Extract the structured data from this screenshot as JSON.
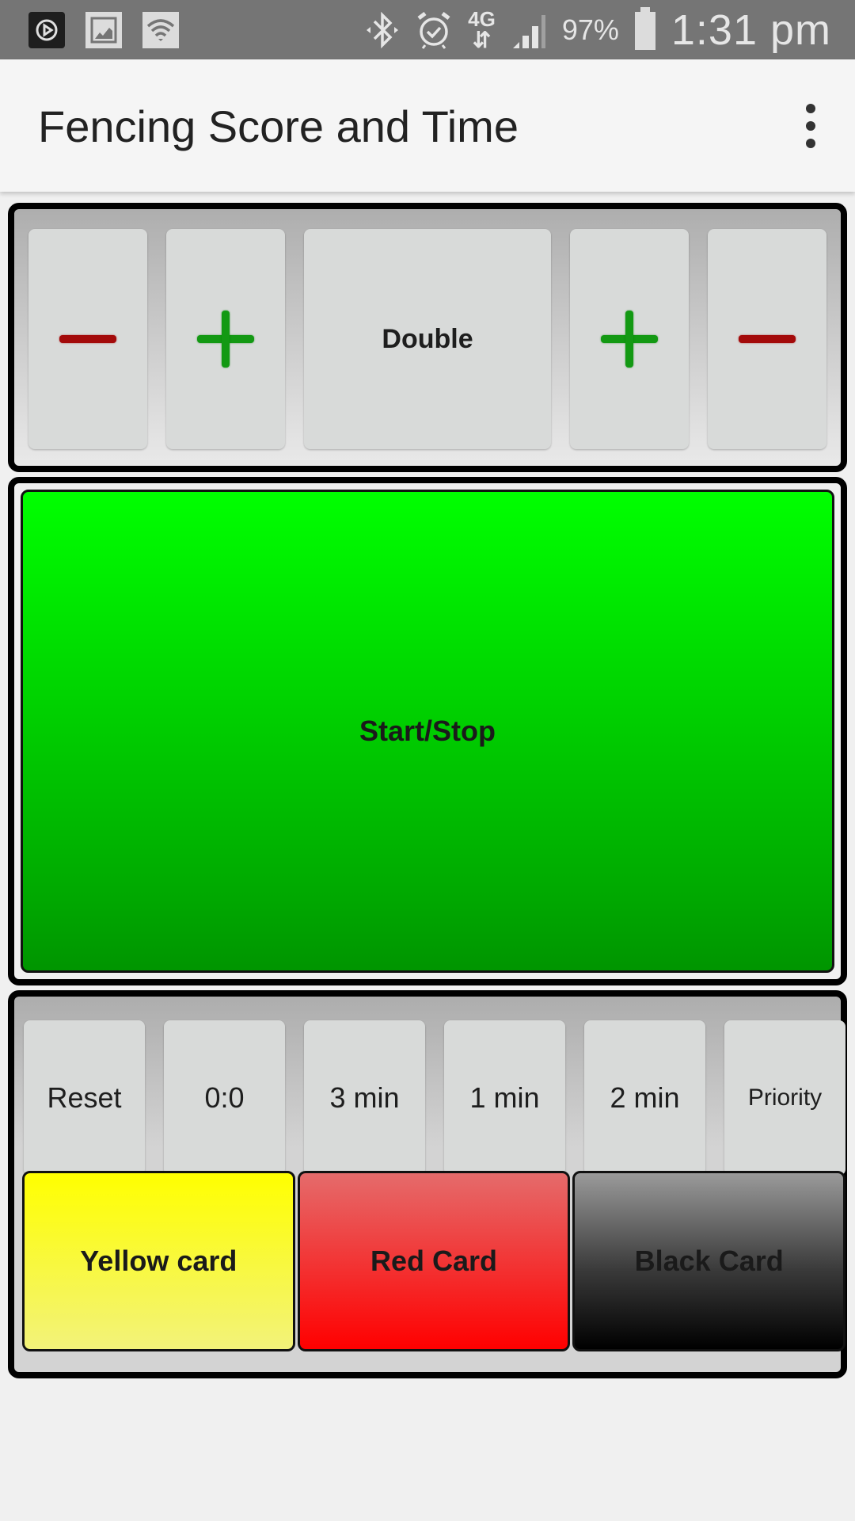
{
  "status_bar": {
    "left_icons": [
      "media-player-icon",
      "image-icon",
      "wifi-icon"
    ],
    "right_icons": [
      "bluetooth-icon",
      "alarm-icon",
      "4g-data-icon",
      "signal-icon",
      "battery-icon"
    ],
    "network_label": "4G",
    "network_arrows": "⇵",
    "battery_percent": "97%",
    "time": "1:31 pm"
  },
  "app_bar": {
    "title": "Fencing Score and Time",
    "menu_icon": "more-vert-icon"
  },
  "score_panel": {
    "left_minus": {
      "icon": "minus-icon",
      "color": "#a30a0a"
    },
    "left_plus": {
      "icon": "plus-icon",
      "color": "#139913"
    },
    "double_label": "Double",
    "right_plus": {
      "icon": "plus-icon",
      "color": "#139913"
    },
    "right_minus": {
      "icon": "minus-icon",
      "color": "#a30a0a"
    }
  },
  "timer_panel": {
    "start_stop_label": "Start/Stop",
    "color": "#00c800"
  },
  "controls_panel": {
    "buttons": [
      {
        "label": "Reset"
      },
      {
        "label": "0:0"
      },
      {
        "label": "3 min"
      },
      {
        "label": "1 min"
      },
      {
        "label": "2 min"
      },
      {
        "label": "Priority"
      }
    ],
    "cards": [
      {
        "label": "Yellow card",
        "color": "#ffff00"
      },
      {
        "label": "Red Card",
        "color": "#ff0000"
      },
      {
        "label": "Black Card",
        "color": "#000000"
      }
    ]
  }
}
